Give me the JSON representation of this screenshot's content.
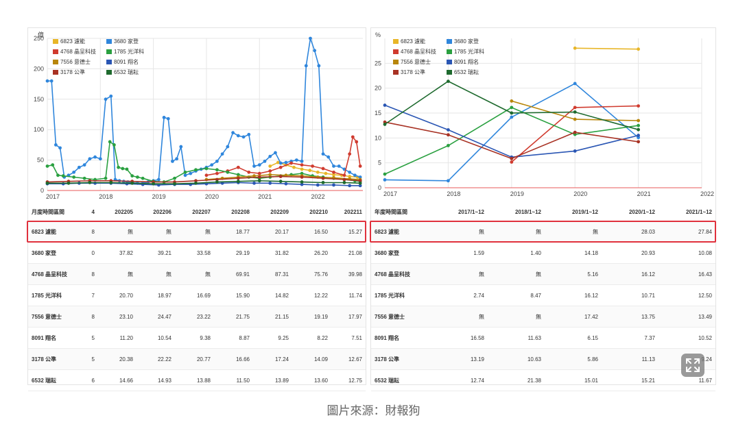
{
  "colors": {
    "s6823": "#e8b628",
    "s3680": "#2f86dc",
    "s4768": "#d03b2f",
    "s1785": "#2aa040",
    "s7556": "#b8860b",
    "s8091": "#2a56b4",
    "s3178": "#a83224",
    "s6532": "#1e6a2e",
    "highlight": "#e0303c"
  },
  "chart_data": [
    {
      "type": "line",
      "ylabel": "億",
      "ylim": [
        0,
        250
      ],
      "yticks": [
        0,
        50,
        100,
        150,
        200,
        250
      ],
      "xlim": [
        2017,
        2022.95
      ],
      "xticks": [
        "2017",
        "2018",
        "2019",
        "2020",
        "2021",
        "2022"
      ],
      "legend_position": "top-left",
      "grid": true,
      "series": [
        {
          "name": "6823 濾能",
          "color_key": "s6823",
          "x": [
            2021.2,
            2021.35,
            2021.5,
            2021.65,
            2021.8,
            2021.95,
            2022.1,
            2022.25,
            2022.4,
            2022.55,
            2022.7,
            2022.85
          ],
          "y": [
            40,
            46,
            42,
            38,
            35,
            33,
            30,
            28,
            26,
            25,
            23,
            22
          ]
        },
        {
          "name": "3680 家登",
          "color_key": "s3680",
          "x": [
            2017.0,
            2017.08,
            2017.16,
            2017.24,
            2017.32,
            2017.4,
            2017.5,
            2017.6,
            2017.7,
            2017.8,
            2017.9,
            2018.0,
            2018.1,
            2018.2,
            2018.28,
            2018.36,
            2018.44,
            2018.52,
            2018.6,
            2018.7,
            2018.8,
            2018.9,
            2019.0,
            2019.1,
            2019.2,
            2019.28,
            2019.36,
            2019.44,
            2019.52,
            2019.6,
            2019.7,
            2019.8,
            2019.9,
            2020.0,
            2020.1,
            2020.2,
            2020.3,
            2020.4,
            2020.5,
            2020.6,
            2020.7,
            2020.8,
            2020.9,
            2021.0,
            2021.1,
            2021.2,
            2021.3,
            2021.4,
            2021.5,
            2021.6,
            2021.7,
            2021.8,
            2021.88,
            2021.96,
            2022.04,
            2022.12,
            2022.2,
            2022.3,
            2022.4,
            2022.5,
            2022.6,
            2022.7,
            2022.8,
            2022.9
          ],
          "y": [
            180,
            180,
            75,
            70,
            22,
            25,
            30,
            38,
            42,
            52,
            55,
            52,
            150,
            155,
            18,
            16,
            15,
            14,
            13,
            12,
            12,
            14,
            16,
            18,
            120,
            118,
            48,
            52,
            72,
            25,
            28,
            32,
            35,
            38,
            42,
            48,
            60,
            72,
            95,
            90,
            88,
            92,
            40,
            42,
            48,
            56,
            62,
            45,
            46,
            48,
            50,
            48,
            205,
            250,
            230,
            205,
            60,
            55,
            40,
            40,
            35,
            30,
            25,
            22
          ]
        },
        {
          "name": "4768 晶呈科技",
          "color_key": "s4768",
          "x": [
            2020.0,
            2020.2,
            2020.4,
            2020.6,
            2020.8,
            2021.0,
            2021.2,
            2021.4,
            2021.6,
            2021.8,
            2022.0,
            2022.2,
            2022.4,
            2022.6,
            2022.7,
            2022.76,
            2022.83,
            2022.9
          ],
          "y": [
            25,
            28,
            32,
            38,
            30,
            28,
            32,
            38,
            45,
            42,
            40,
            36,
            30,
            25,
            60,
            88,
            80,
            40
          ]
        },
        {
          "name": "1785 光洋科",
          "color_key": "s1785",
          "x": [
            2017.0,
            2017.1,
            2017.2,
            2017.3,
            2017.5,
            2017.7,
            2017.9,
            2018.1,
            2018.18,
            2018.26,
            2018.34,
            2018.42,
            2018.5,
            2018.6,
            2018.7,
            2018.8,
            2019.0,
            2019.2,
            2019.4,
            2019.6,
            2019.8,
            2020.0,
            2020.2,
            2020.4,
            2020.6,
            2020.8,
            2021.0,
            2021.2,
            2021.4,
            2021.6,
            2021.8,
            2022.0,
            2022.2,
            2022.4,
            2022.6,
            2022.8,
            2022.9
          ],
          "y": [
            40,
            42,
            25,
            24,
            22,
            20,
            18,
            20,
            80,
            75,
            38,
            36,
            35,
            24,
            22,
            20,
            15,
            14,
            20,
            30,
            34,
            36,
            34,
            30,
            26,
            22,
            20,
            22,
            24,
            26,
            28,
            24,
            22,
            20,
            18,
            16,
            15
          ]
        },
        {
          "name": "7556 意德士",
          "color_key": "s7556",
          "x": [
            2020.0,
            2020.3,
            2020.6,
            2020.9,
            2021.2,
            2021.5,
            2021.8,
            2022.1,
            2022.4,
            2022.7,
            2022.9
          ],
          "y": [
            18,
            20,
            22,
            24,
            26,
            25,
            24,
            22,
            21,
            19,
            18
          ]
        },
        {
          "name": "8091 翔名",
          "color_key": "s8091",
          "x": [
            2017.0,
            2017.3,
            2017.6,
            2017.9,
            2018.2,
            2018.5,
            2018.8,
            2019.1,
            2019.4,
            2019.7,
            2020.0,
            2020.3,
            2020.6,
            2020.9,
            2021.2,
            2021.5,
            2021.8,
            2022.1,
            2022.4,
            2022.7,
            2022.9
          ],
          "y": [
            11,
            11,
            12,
            12,
            12,
            11,
            10,
            9,
            10,
            10,
            11,
            12,
            13,
            12,
            12,
            11,
            10,
            9,
            9,
            8,
            8
          ]
        },
        {
          "name": "3178 公準",
          "color_key": "s3178",
          "x": [
            2017.0,
            2017.4,
            2017.8,
            2018.2,
            2018.6,
            2019.0,
            2019.4,
            2019.8,
            2020.2,
            2020.6,
            2021.0,
            2021.4,
            2021.8,
            2022.2,
            2022.6,
            2022.9
          ],
          "y": [
            14,
            15,
            16,
            16,
            15,
            14,
            14,
            16,
            18,
            20,
            22,
            23,
            22,
            20,
            18,
            16
          ]
        },
        {
          "name": "6532 瑞耘",
          "color_key": "s6532",
          "x": [
            2017.0,
            2017.4,
            2017.8,
            2018.2,
            2018.6,
            2019.0,
            2019.4,
            2019.8,
            2020.2,
            2020.6,
            2021.0,
            2021.4,
            2021.8,
            2022.2,
            2022.6,
            2022.9
          ],
          "y": [
            12,
            12,
            13,
            13,
            12,
            11,
            11,
            12,
            14,
            15,
            16,
            15,
            14,
            13,
            13,
            12
          ]
        }
      ]
    },
    {
      "type": "line",
      "ylabel": "%",
      "ylim": [
        0,
        30
      ],
      "yticks": [
        0,
        5,
        10,
        15,
        20,
        25
      ],
      "xlim": [
        2017,
        2022
      ],
      "xticks": [
        "2017",
        "2018",
        "2019",
        "2020",
        "2021",
        "2022"
      ],
      "legend_position": "top-left",
      "grid": true,
      "series": [
        {
          "name": "6823 濾能",
          "color_key": "s6823",
          "x": [
            2020,
            2021
          ],
          "y": [
            28.03,
            27.84
          ]
        },
        {
          "name": "3680 家登",
          "color_key": "s3680",
          "x": [
            2017,
            2018,
            2019,
            2020,
            2021
          ],
          "y": [
            1.59,
            1.4,
            14.18,
            20.93,
            10.08
          ]
        },
        {
          "name": "4768 晶呈科技",
          "color_key": "s4768",
          "x": [
            2019,
            2020,
            2021
          ],
          "y": [
            5.16,
            16.12,
            16.43
          ]
        },
        {
          "name": "1785 光洋科",
          "color_key": "s1785",
          "x": [
            2017,
            2018,
            2019,
            2020,
            2021
          ],
          "y": [
            2.74,
            8.47,
            16.12,
            10.71,
            12.5
          ]
        },
        {
          "name": "7556 意德士",
          "color_key": "s7556",
          "x": [
            2019,
            2020,
            2021
          ],
          "y": [
            17.42,
            13.75,
            13.49
          ]
        },
        {
          "name": "8091 翔名",
          "color_key": "s8091",
          "x": [
            2017,
            2018,
            2019,
            2020,
            2021
          ],
          "y": [
            16.58,
            11.63,
            6.15,
            7.37,
            10.52
          ]
        },
        {
          "name": "3178 公準",
          "color_key": "s3178",
          "x": [
            2017,
            2018,
            2019,
            2020,
            2021
          ],
          "y": [
            13.19,
            10.63,
            5.86,
            11.13,
            9.24
          ]
        },
        {
          "name": "6532 瑞耘",
          "color_key": "s6532",
          "x": [
            2017,
            2018,
            2019,
            2020,
            2021
          ],
          "y": [
            12.74,
            21.38,
            15.01,
            15.21,
            11.67
          ]
        }
      ]
    }
  ],
  "left_table": {
    "headers": [
      "月度時間區間",
      "4",
      "202205",
      "202206",
      "202207",
      "202208",
      "202209",
      "202210",
      "202211"
    ],
    "rows": [
      [
        "6823 濾能",
        "8",
        "無",
        "無",
        "無",
        "18.77",
        "20.17",
        "16.50",
        "15.27"
      ],
      [
        "3680 家登",
        "0",
        "37.82",
        "39.21",
        "33.58",
        "29.19",
        "31.82",
        "26.20",
        "21.08"
      ],
      [
        "4768 晶呈科技",
        "8",
        "無",
        "無",
        "無",
        "69.91",
        "87.31",
        "75.76",
        "39.98"
      ],
      [
        "1785 光洋科",
        "7",
        "20.70",
        "18.97",
        "16.69",
        "15.90",
        "14.82",
        "12.22",
        "11.74"
      ],
      [
        "7556 意德士",
        "8",
        "23.10",
        "24.47",
        "23.22",
        "21.75",
        "21.15",
        "19.19",
        "17.97"
      ],
      [
        "8091 翔名",
        "5",
        "11.20",
        "10.54",
        "9.38",
        "8.87",
        "9.25",
        "8.22",
        "7.51"
      ],
      [
        "3178 公準",
        "5",
        "20.38",
        "22.22",
        "20.77",
        "16.66",
        "17.24",
        "14.09",
        "12.67"
      ],
      [
        "6532 瑞耘",
        "6",
        "14.66",
        "14.93",
        "13.88",
        "11.50",
        "13.89",
        "13.60",
        "12.75"
      ]
    ]
  },
  "right_table": {
    "headers": [
      "年度時間區間",
      "2017/1~12",
      "2018/1~12",
      "2019/1~12",
      "2020/1~12",
      "2021/1~12"
    ],
    "rows": [
      [
        "6823 濾能",
        "無",
        "無",
        "無",
        "28.03",
        "27.84"
      ],
      [
        "3680 家登",
        "1.59",
        "1.40",
        "14.18",
        "20.93",
        "10.08"
      ],
      [
        "4768 晶呈科技",
        "無",
        "無",
        "5.16",
        "16.12",
        "16.43"
      ],
      [
        "1785 光洋科",
        "2.74",
        "8.47",
        "16.12",
        "10.71",
        "12.50"
      ],
      [
        "7556 意德士",
        "無",
        "無",
        "17.42",
        "13.75",
        "13.49"
      ],
      [
        "8091 翔名",
        "16.58",
        "11.63",
        "6.15",
        "7.37",
        "10.52"
      ],
      [
        "3178 公準",
        "13.19",
        "10.63",
        "5.86",
        "11.13",
        "9.24"
      ],
      [
        "6532 瑞耘",
        "12.74",
        "21.38",
        "15.01",
        "15.21",
        "11.67"
      ]
    ]
  },
  "caption": "圖片來源：財報狗",
  "expand_icon": "expand-icon"
}
